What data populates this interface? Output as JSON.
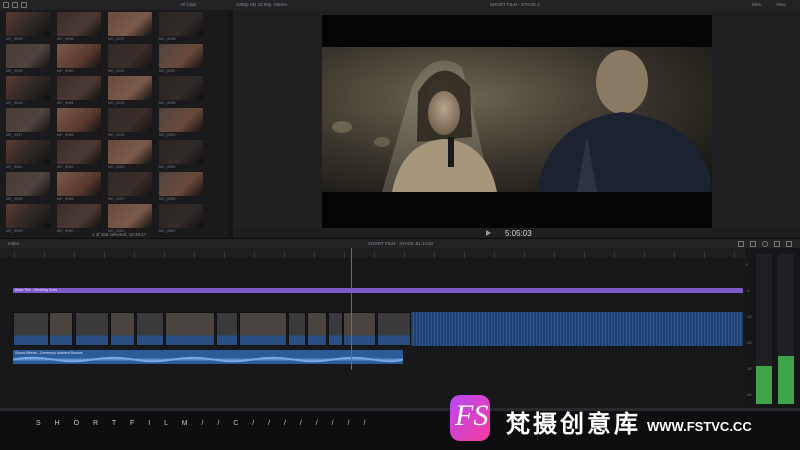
{
  "browser": {
    "filter_label": "All Clips",
    "status": "1 of 156 selected, 18:38:17",
    "clips": [
      {
        "label": "MC_0035"
      },
      {
        "label": "MC_0036"
      },
      {
        "label": "MC_0037"
      },
      {
        "label": "MC_0038"
      },
      {
        "label": "MC_0039"
      },
      {
        "label": "MC_0040"
      },
      {
        "label": "MC_0041"
      },
      {
        "label": "MC_0042"
      },
      {
        "label": "MC_0043"
      },
      {
        "label": "MC_0044"
      },
      {
        "label": "MC_0045"
      },
      {
        "label": "MC_0046"
      },
      {
        "label": "MC_0047"
      },
      {
        "label": "MC_0048"
      },
      {
        "label": "MC_0049"
      },
      {
        "label": "MC_0050"
      },
      {
        "label": "MC_0051"
      },
      {
        "label": "MC_0052"
      },
      {
        "label": "MC_0053"
      },
      {
        "label": "MC_0054"
      },
      {
        "label": "MC_0055"
      },
      {
        "label": "MC_0056"
      },
      {
        "label": "MC_0057"
      },
      {
        "label": "MC_0058"
      },
      {
        "label": "MC_0059"
      },
      {
        "label": "MC_0060"
      },
      {
        "label": "MC_0061"
      },
      {
        "label": "MC_0062"
      }
    ]
  },
  "viewer": {
    "format": "1080p HD 23.98p, Stereo",
    "project_title": "SHORT FILM - STAGE 4",
    "zoom": "65%",
    "view_label": "View",
    "timecode": "5:05:03"
  },
  "timeline": {
    "index_label": "Index",
    "title": "SHORT FILM - STAGE 4",
    "duration": "11:14:04",
    "title_clip_label": "Basic Title - Wedding Vows",
    "audio_clip_label": "Sound Effects - Ceremony Ambient Sounds",
    "meter_scale": [
      "0",
      "-6",
      "-12",
      "-20",
      "-30",
      "-50"
    ]
  },
  "bottom_bar": {
    "scrub_text": "S H O R T   F I L M   / /   C   / /   / /   / /   / /"
  },
  "watermark": {
    "logo_text": "FS",
    "site_cn": "梵摄创意库",
    "site_url": "WWW.FSTVC.CC"
  },
  "colors": {
    "accent_blue": "#5aa0ff",
    "title_purple": "#7a5bc8",
    "audio_blue": "#2b5c9a",
    "playhead_red": "#e03c3c",
    "meter_green": "#3fa34a"
  }
}
